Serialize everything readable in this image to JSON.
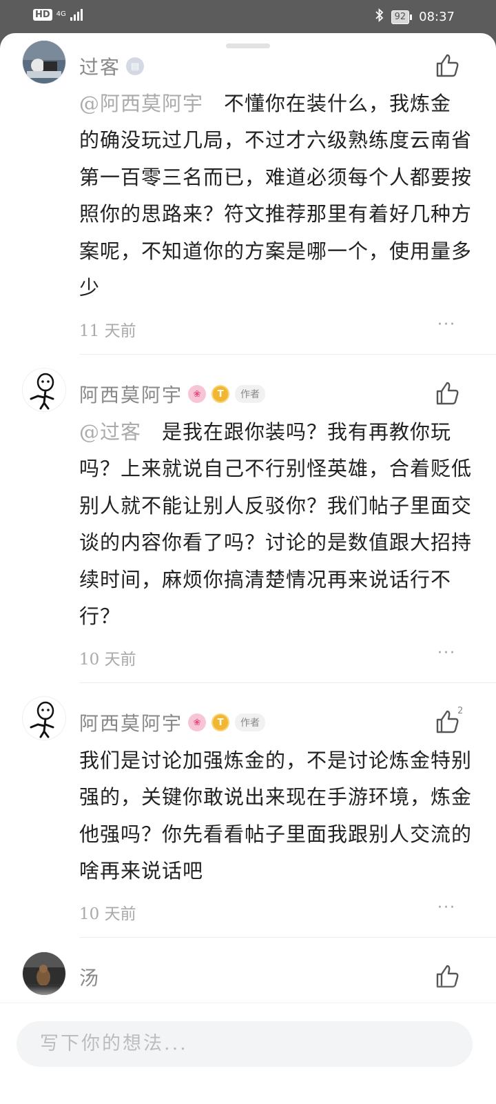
{
  "status_bar": {
    "hd_label": "HD",
    "network": "4G",
    "battery": "92",
    "time": "08:37"
  },
  "comments": [
    {
      "user": "过客",
      "body": "不懂你在装什么，我炼金的确没玩过几局，不过才六级熟练度云南省第一百零三名而已，难道必须每个人都要按照你的思路来？符文推荐那里有着好几种方案呢，不知道你的方案是哪一个，使用量多少",
      "mention": "@阿西莫阿宇",
      "time": "11  天前",
      "more": "···"
    },
    {
      "user": "阿西莫阿宇",
      "author_tag": "作者",
      "mention": "@过客",
      "body": "是我在跟你装吗？我有再教你玩吗？上来就说自己不行别怪英雄，合着贬低别人就不能让别人反驳你？我们帖子里面交谈的内容你看了吗？讨论的是数值跟大招持续时间，麻烦你搞清楚情况再来说话行不行？",
      "time": "10  天前",
      "more": "···"
    },
    {
      "user": "阿西莫阿宇",
      "author_tag": "作者",
      "like_count": "2",
      "body": "我们是讨论加强炼金的，不是讨论炼金特别强的，关键你敢说出来现在手游环境，炼金他强吗？你先看看帖子里面我跟别人交流的啥再来说话吧",
      "time": "10  天前",
      "more": "···"
    },
    {
      "user": "汤"
    }
  ],
  "composer": {
    "placeholder": "写下你的想法..."
  }
}
